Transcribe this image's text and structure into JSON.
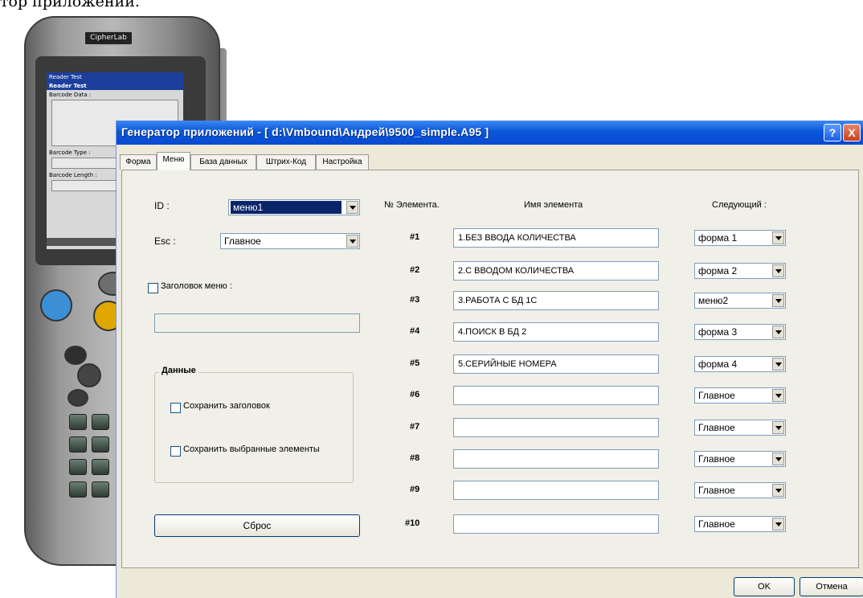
{
  "caption": "тор приложений.",
  "device": {
    "logo": "CipherLab",
    "screen": {
      "title_bar": "Reader Test",
      "sub_title": "Reader Test",
      "barcode_data_label": "Barcode Data :",
      "barcode_type_label": "Barcode Type :",
      "barcode_length_label": "Barcode Length :"
    }
  },
  "window": {
    "title": "Генератор приложений - [ d:\\Vmbound\\Андрей\\9500_simple.A95 ]",
    "help_btn": "?",
    "close_btn": "X"
  },
  "tabs": [
    "Форма",
    "Меню",
    "База данных",
    "Штрих-Код",
    "Настройка"
  ],
  "active_tab": "Меню",
  "left": {
    "id_label": "ID :",
    "id_value": "меню1",
    "esc_label": "Esc :",
    "esc_value": "Главное",
    "menu_header_label": "Заголовок меню :",
    "menu_header_value": "",
    "data_group_title": "Данные",
    "save_header_label": "Сохранить заголовок",
    "save_selected_label": "Сохранить выбранные элементы",
    "reset_button": "Сброс"
  },
  "table": {
    "col_num": "№ Элемента.",
    "col_name": "Имя элемента",
    "col_next": "Следующий :",
    "rows": [
      {
        "num": "#1",
        "name": "1.БЕЗ ВВОДА КОЛИЧЕСТВА",
        "next": "форма 1"
      },
      {
        "num": "#2",
        "name": "2.С ВВОДОМ КОЛИЧЕСТВА",
        "next": "форма 2"
      },
      {
        "num": "#3",
        "name": "3.РАБОТА С БД 1С",
        "next": "меню2"
      },
      {
        "num": "#4",
        "name": "4.ПОИСК В БД 2",
        "next": "форма 3"
      },
      {
        "num": "#5",
        "name": "5.СЕРИЙНЫЕ НОМЕРА",
        "next": "форма 4"
      },
      {
        "num": "#6",
        "name": "",
        "next": "Главное"
      },
      {
        "num": "#7",
        "name": "",
        "next": "Главное"
      },
      {
        "num": "#8",
        "name": "",
        "next": "Главное"
      },
      {
        "num": "#9",
        "name": "",
        "next": "Главное"
      },
      {
        "num": "#10",
        "name": "",
        "next": "Главное"
      }
    ]
  },
  "footer": {
    "ok": "OK",
    "cancel": "Отмена"
  }
}
